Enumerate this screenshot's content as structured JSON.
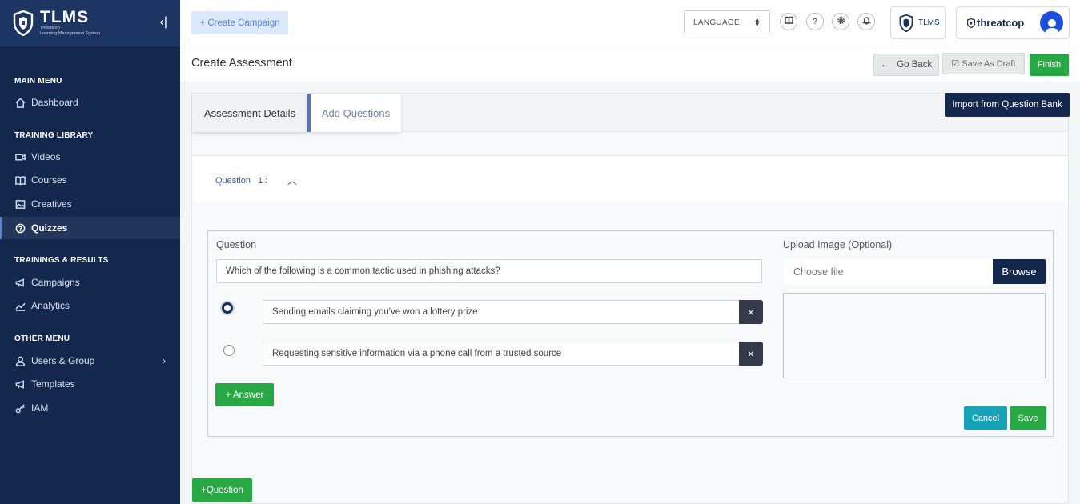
{
  "brand": {
    "title": "TLMS",
    "subtitle_line1": "Threatcop",
    "subtitle_line2": "Learning Management System",
    "collapse_glyph": "‹|"
  },
  "sidebar": {
    "sections": [
      {
        "title": "MAIN MENU",
        "items": [
          {
            "label": "Dashboard",
            "icon": "home-icon"
          }
        ]
      },
      {
        "title": "TRAINING LIBRARY",
        "items": [
          {
            "label": "Videos",
            "icon": "video-icon"
          },
          {
            "label": "Courses",
            "icon": "book-icon"
          },
          {
            "label": "Creatives",
            "icon": "image-icon"
          },
          {
            "label": "Quizzes",
            "icon": "question-circle-icon",
            "active": true
          }
        ]
      },
      {
        "title": "TRAININGS & RESULTS",
        "items": [
          {
            "label": "Campaigns",
            "icon": "megaphone-icon"
          },
          {
            "label": "Analytics",
            "icon": "chart-line-icon"
          }
        ]
      },
      {
        "title": "OTHER MENU",
        "items": [
          {
            "label": "Users & Group",
            "icon": "user-icon",
            "has_submenu": true
          },
          {
            "label": "Templates",
            "icon": "megaphone-icon"
          },
          {
            "label": "IAM",
            "icon": "key-icon"
          }
        ]
      }
    ]
  },
  "topbar": {
    "create_campaign": "+ Create Campaign",
    "language": "LANGUAGE",
    "icon_buttons": [
      "book-icon",
      "help-icon",
      "settings-icon",
      "bell-icon"
    ],
    "help_glyph": "?",
    "tlms_label": "TLMS",
    "threatcop_label": "threatcop"
  },
  "page": {
    "title": "Create Assessment",
    "go_back": "Go Back",
    "save_draft": "Save As Draft",
    "finish": "Finish"
  },
  "tabs": {
    "details": "Assessment Details",
    "questions": "Add Questions",
    "import": "Import from Question Bank"
  },
  "question": {
    "label": "Question",
    "number": "1 :",
    "field_label": "Question",
    "text": "Which of the following is a common tactic used in phishing attacks?",
    "answers": [
      {
        "text": "Sending emails claiming you've won a lottery prize",
        "selected": true
      },
      {
        "text": "Requesting sensitive information via a phone call from a trusted source",
        "selected": false
      }
    ],
    "delete_glyph": "×",
    "add_answer": "+ Answer",
    "upload_label": "Upload Image (Optional)",
    "choose_file": "Choose file",
    "browse": "Browse",
    "cancel": "Cancel",
    "save": "Save"
  },
  "add_question": "+Question",
  "colors": {
    "sidebar_bg": "#14284d",
    "primary_dark": "#14284d",
    "success": "#28a745",
    "info": "#17a2b8",
    "link_blue": "#6b7fc0"
  }
}
